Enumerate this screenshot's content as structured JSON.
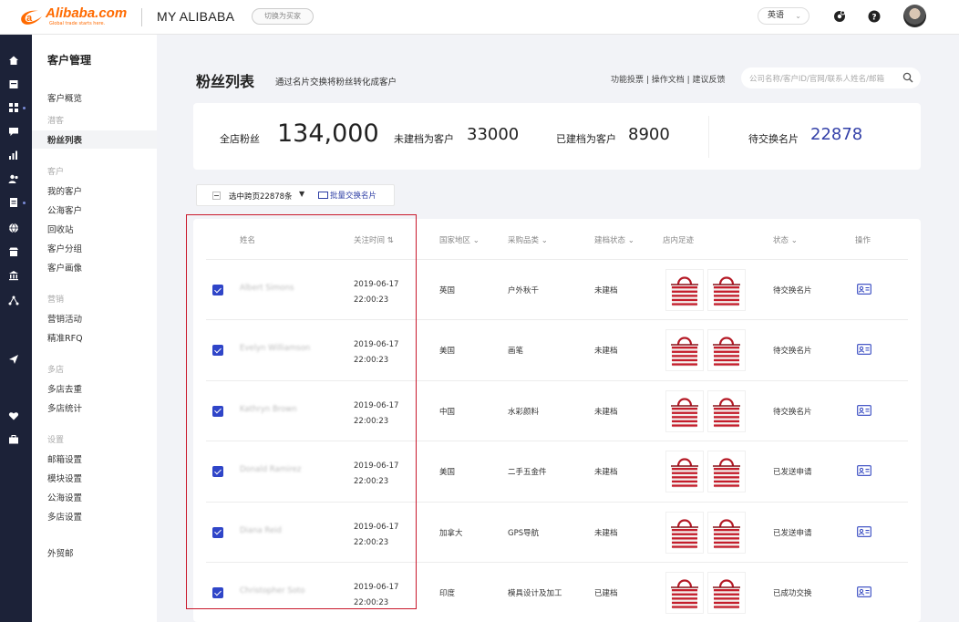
{
  "header": {
    "logo_text": "Alibaba.com",
    "logo_tagline": "Global trade starts here.",
    "app_title": "MY ALIBABA",
    "switch_label": "切换为买家",
    "language": "英语"
  },
  "subnav": {
    "title": "客户管理",
    "items": [
      {
        "label": "客户概览",
        "type": "item"
      },
      {
        "label": "潜客",
        "type": "group"
      },
      {
        "label": "粉丝列表",
        "type": "item",
        "active": true
      },
      {
        "label": "客户",
        "type": "group"
      },
      {
        "label": "我的客户",
        "type": "item"
      },
      {
        "label": "公海客户",
        "type": "item"
      },
      {
        "label": "回收站",
        "type": "item"
      },
      {
        "label": "客户分组",
        "type": "item"
      },
      {
        "label": "客户画像",
        "type": "item"
      },
      {
        "label": "营销",
        "type": "group"
      },
      {
        "label": "营销活动",
        "type": "item"
      },
      {
        "label": "精准RFQ",
        "type": "item"
      },
      {
        "label": "多店",
        "type": "group"
      },
      {
        "label": "多店去重",
        "type": "item"
      },
      {
        "label": "多店统计",
        "type": "item"
      },
      {
        "label": "设置",
        "type": "group"
      },
      {
        "label": "邮箱设置",
        "type": "item"
      },
      {
        "label": "模块设置",
        "type": "item"
      },
      {
        "label": "公海设置",
        "type": "item"
      },
      {
        "label": "多店设置",
        "type": "item"
      },
      {
        "label": "外贸邮",
        "type": "item"
      }
    ]
  },
  "page": {
    "title": "粉丝列表",
    "subtitle": "通过名片交换将粉丝转化成客户",
    "help_links": "功能投票 | 操作文档 | 建议反馈",
    "search_placeholder": "公司名称/客户ID/官网/联系人姓名/邮箱"
  },
  "stats": {
    "total_label": "全店粉丝",
    "total_value": "134,000",
    "unfiled_label": "未建档为客户",
    "unfiled_value": "33000",
    "filed_label": "已建档为客户",
    "filed_value": "8900",
    "pending_label": "待交换名片",
    "pending_value": "22878"
  },
  "batch": {
    "select_label": "选中跨页22878条",
    "exchange_label": "批量交换名片"
  },
  "table": {
    "headers": {
      "name": "姓名",
      "follow_time": "关注时间",
      "country": "国家地区",
      "category": "采购品类",
      "filing": "建档状态",
      "footprint": "店内足迹",
      "status": "状态",
      "action": "操作"
    },
    "rows": [
      {
        "name": "Albert Simons",
        "date": "2019-06-17",
        "time": "22:00:23",
        "country": "英国",
        "category": "户外秋千",
        "filing": "未建档",
        "status": "待交换名片"
      },
      {
        "name": "Evelyn Williamson",
        "date": "2019-06-17",
        "time": "22:00:23",
        "country": "美国",
        "category": "画笔",
        "filing": "未建档",
        "status": "待交换名片"
      },
      {
        "name": "Kathryn Brown",
        "date": "2019-06-17",
        "time": "22:00:23",
        "country": "中国",
        "category": "水彩颜料",
        "filing": "未建档",
        "status": "待交换名片"
      },
      {
        "name": "Donald Ramirez",
        "date": "2019-06-17",
        "time": "22:00:23",
        "country": "美国",
        "category": "二手五金件",
        "filing": "未建档",
        "status": "已发送申请"
      },
      {
        "name": "Diana Reid",
        "date": "2019-06-17",
        "time": "22:00:23",
        "country": "加拿大",
        "category": "GPS导航",
        "filing": "未建档",
        "status": "已发送申请"
      },
      {
        "name": "Christopher Soto",
        "date": "2019-06-17",
        "time": "22:00:23",
        "country": "印度",
        "category": "模具设计及加工",
        "filing": "已建档",
        "status": "已成功交换"
      }
    ]
  },
  "colors": {
    "accent": "#2f45c8",
    "highlight": "#c9182b",
    "brand": "#ff6a00"
  }
}
